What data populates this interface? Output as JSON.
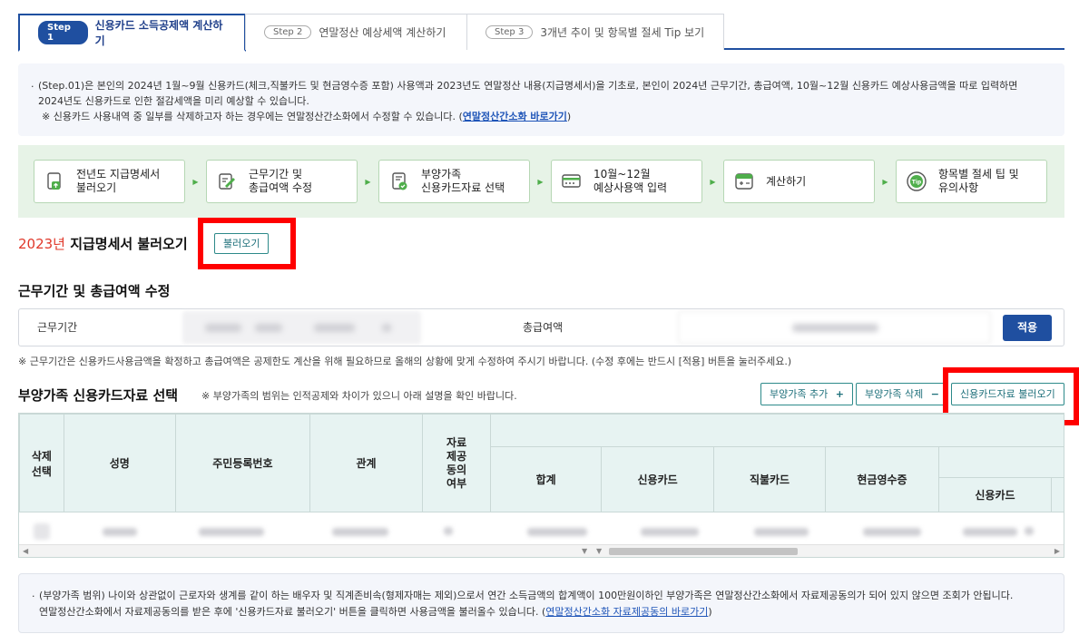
{
  "tabs": [
    {
      "step": "Step 1",
      "label": "신용카드 소득공제액 계산하기",
      "active": true
    },
    {
      "step": "Step 2",
      "label": "연말정산 예상세액 계산하기",
      "active": false
    },
    {
      "step": "Step 3",
      "label": "3개년 추이 및 항목별 절세 Tip 보기",
      "active": false
    }
  ],
  "info": {
    "line1": "(Step.01)은 본인의 2024년 1월~9월 신용카드(체크,직불카드 및 현금영수증 포함) 사용액과 2023년도 연말정산 내용(지급명세서)을 기초로, 본인이 2024년 근무기간, 총급여액, 10월~12월 신용카드 예상사용금액을 따로 입력하면",
    "line2": "2024년도 신용카드로 인한 절감세액을 미리 예상할 수 있습니다.",
    "line3_prefix": "※ 신용카드 사용내역 중 일부를 삭제하고자 하는 경우에는 연말정산간소화에서 수정할 수 있습니다. (",
    "line3_link": "연말정산간소화 바로가기",
    "line3_suffix": ")"
  },
  "process": [
    {
      "line1": "전년도 지급명세서",
      "line2": "불러오기",
      "icon": "document-upload-icon"
    },
    {
      "line1": "근무기간 및",
      "line2": "총급여액 수정",
      "icon": "edit-document-icon"
    },
    {
      "line1": "부양가족",
      "line2": "신용카드자료 선택",
      "icon": "check-document-icon"
    },
    {
      "line1": "10월~12월",
      "line2": "예상사용액 입력",
      "icon": "card-input-icon"
    },
    {
      "line1": "계산하기",
      "line2": "",
      "icon": "calculator-icon"
    },
    {
      "line1": "항목별 절세 팁 및",
      "line2": "유의사항",
      "icon": "tip-icon"
    }
  ],
  "statement": {
    "year": "2023년",
    "title": " 지급명세서 불러오기",
    "button": "불러오기"
  },
  "work": {
    "title": "근무기간 및 총급여액 수정",
    "period_label": "근무기간",
    "salary_label": "총급여액",
    "apply_button": "적용",
    "note": "※ 근무기간은 신용카드사용금액을 확정하고 총급여액은 공제한도 계산을 위해 필요하므로 올해의 상황에 맞게 수정하여 주시기 바랍니다. (수정 후에는 반드시 [적용] 버튼을 눌러주세요.)"
  },
  "dependents": {
    "title": "부양가족 신용카드자료 선택",
    "note": "※ 부양가족의 범위는 인적공제와 차이가 있으니 아래 설명을 확인 바랍니다.",
    "add_button": "부양가족 추가",
    "add_symbol": "+",
    "delete_button": "부양가족 삭제",
    "delete_symbol": "−",
    "load_button": "신용카드자료 불러오기",
    "columns": {
      "delete_select": [
        "삭제",
        "선택"
      ],
      "name": "성명",
      "resident_no": "주민등록번호",
      "relation": "관계",
      "consent": [
        "자료",
        "제공",
        "동의",
        "여부"
      ],
      "top_group": "신용",
      "total": "합계",
      "credit_card": "신용카드",
      "debit_card": "직불카드",
      "cash_receipt": "현금영수증",
      "sub_credit_card": "신용카드",
      "sub_group_mark": "-"
    }
  },
  "bottom_info": {
    "line1": "(부양가족 범위) 나이와 상관없이 근로자와 생계를 같이 하는 배우자 및 직계존비속(형제자매는 제외)으로서 연간 소득금액의 합계액이 100만원이하인 부양가족은 연말정산간소화에서 자료제공동의가 되어 있지 않으면 조회가 안됩니다.",
    "line2_prefix": "연말정산간소화에서 자료제공동의를 받은 후에 '신용카드자료 불러오기' 버튼을 클릭하면 사용금액을 불러올수 있습니다. (",
    "line2_link": "연말정산간소화 자료제공동의 바로가기",
    "line2_suffix": ")"
  },
  "colors": {
    "primary": "#1f4fa0",
    "teal": "#1d6f7a",
    "highlight": "#ff0000",
    "process_bg": "#e7f3e7"
  }
}
